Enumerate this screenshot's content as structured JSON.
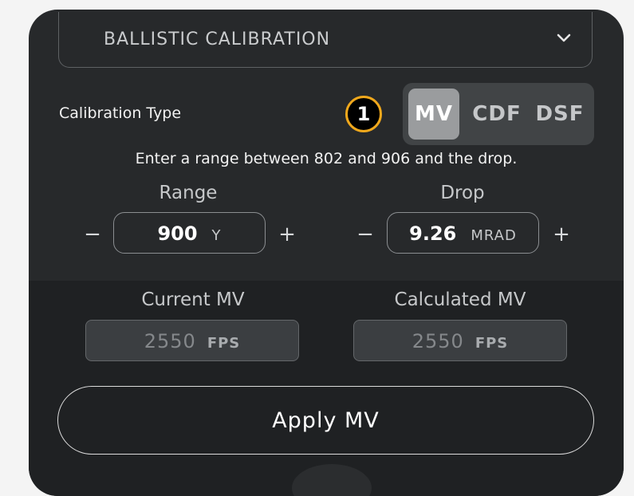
{
  "dropdown": {
    "label": "BALLISTIC CALIBRATION",
    "icon": "chevron-down-icon"
  },
  "calibration": {
    "label": "Calibration Type",
    "step_badge": "1",
    "options": [
      "MV",
      "CDF",
      "DSF"
    ],
    "selected": "MV"
  },
  "hint": "Enter a range between 802 and 906 and the drop.",
  "range": {
    "title": "Range",
    "value": "900",
    "unit": "Y",
    "minus": "−",
    "plus": "+"
  },
  "drop": {
    "title": "Drop",
    "value": "9.26",
    "unit": "MRAD",
    "minus": "−",
    "plus": "+"
  },
  "current_mv": {
    "title": "Current MV",
    "value": "2550",
    "unit": "FPS"
  },
  "calculated_mv": {
    "title": "Calculated MV",
    "value": "2550",
    "unit": "FPS"
  },
  "apply_label": "Apply MV",
  "colors": {
    "accent": "#f0a81c",
    "panel": "#27292b",
    "segment_active": "#9a9c9e"
  }
}
